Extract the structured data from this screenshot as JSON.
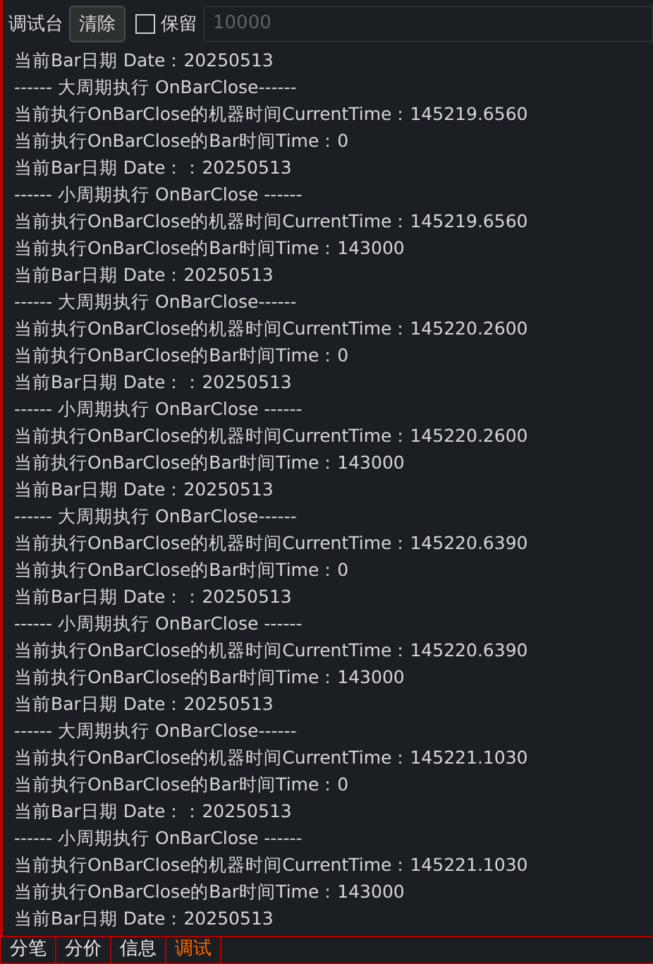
{
  "toolbar": {
    "title": "调试台",
    "clear_button": "清除",
    "keep": {
      "label": "保留",
      "checked": false
    },
    "limit": {
      "placeholder": "10000"
    }
  },
  "log_lines": [
    "当前Bar日期 Date：20250513",
    "------ 大周期执行 OnBarClose------",
    "当前执行OnBarClose的机器时间CurrentTime：145219.6560",
    "当前执行OnBarClose的Bar时间Time：0",
    "当前Bar日期 Date：：20250513",
    "------ 小周期执行 OnBarClose ------",
    "当前执行OnBarClose的机器时间CurrentTime：145219.6560",
    "当前执行OnBarClose的Bar时间Time：143000",
    "当前Bar日期 Date：20250513",
    "------ 大周期执行 OnBarClose------",
    "当前执行OnBarClose的机器时间CurrentTime：145220.2600",
    "当前执行OnBarClose的Bar时间Time：0",
    "当前Bar日期 Date：：20250513",
    "------ 小周期执行 OnBarClose ------",
    "当前执行OnBarClose的机器时间CurrentTime：145220.2600",
    "当前执行OnBarClose的Bar时间Time：143000",
    "当前Bar日期 Date：20250513",
    "------ 大周期执行 OnBarClose------",
    "当前执行OnBarClose的机器时间CurrentTime：145220.6390",
    "当前执行OnBarClose的Bar时间Time：0",
    "当前Bar日期 Date：：20250513",
    "------ 小周期执行 OnBarClose ------",
    "当前执行OnBarClose的机器时间CurrentTime：145220.6390",
    "当前执行OnBarClose的Bar时间Time：143000",
    "当前Bar日期 Date：20250513",
    "------ 大周期执行 OnBarClose------",
    "当前执行OnBarClose的机器时间CurrentTime：145221.1030",
    "当前执行OnBarClose的Bar时间Time：0",
    "当前Bar日期 Date：：20250513",
    "------ 小周期执行 OnBarClose ------",
    "当前执行OnBarClose的机器时间CurrentTime：145221.1030",
    "当前执行OnBarClose的Bar时间Time：143000",
    "当前Bar日期 Date：20250513"
  ],
  "tabs": [
    {
      "label": "分笔",
      "selected": false
    },
    {
      "label": "分价",
      "selected": false
    },
    {
      "label": "信息",
      "selected": false
    },
    {
      "label": "调试",
      "selected": true
    }
  ]
}
